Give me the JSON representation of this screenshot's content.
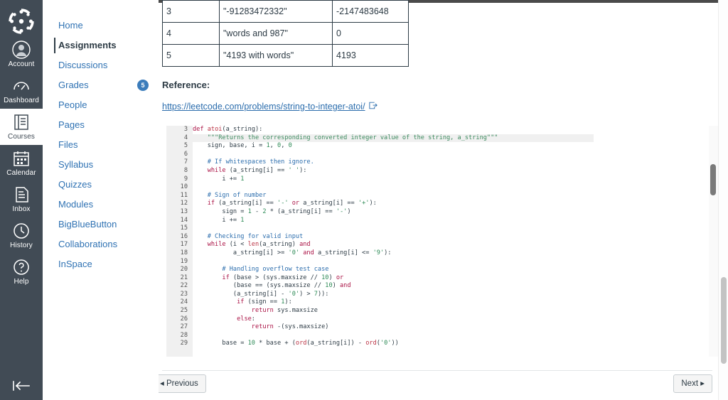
{
  "global_nav": {
    "logo": "canvas-logo",
    "items": [
      {
        "label": "Account",
        "icon": "account-avatar-icon",
        "active": false
      },
      {
        "label": "Dashboard",
        "icon": "dashboard-icon",
        "active": false
      },
      {
        "label": "Courses",
        "icon": "courses-book-icon",
        "active": true
      },
      {
        "label": "Calendar",
        "icon": "calendar-icon",
        "active": false
      },
      {
        "label": "Inbox",
        "icon": "inbox-icon",
        "active": false
      },
      {
        "label": "History",
        "icon": "history-clock-icon",
        "active": false
      },
      {
        "label": "Help",
        "icon": "help-question-icon",
        "active": false
      }
    ],
    "collapse_icon": "collapse-left-icon"
  },
  "course_nav": {
    "items": [
      {
        "label": "Home",
        "active": false,
        "badge": ""
      },
      {
        "label": "Assignments",
        "active": true,
        "badge": ""
      },
      {
        "label": "Discussions",
        "active": false,
        "badge": ""
      },
      {
        "label": "Grades",
        "active": false,
        "badge": "5"
      },
      {
        "label": "People",
        "active": false,
        "badge": ""
      },
      {
        "label": "Pages",
        "active": false,
        "badge": ""
      },
      {
        "label": "Files",
        "active": false,
        "badge": ""
      },
      {
        "label": "Syllabus",
        "active": false,
        "badge": ""
      },
      {
        "label": "Quizzes",
        "active": false,
        "badge": ""
      },
      {
        "label": "Modules",
        "active": false,
        "badge": ""
      },
      {
        "label": "BigBlueButton",
        "active": false,
        "badge": ""
      },
      {
        "label": "Collaborations",
        "active": false,
        "badge": ""
      },
      {
        "label": "InSpace",
        "active": false,
        "badge": ""
      }
    ]
  },
  "main": {
    "examples_table": {
      "rows": [
        {
          "num": "3",
          "input": "\"-91283472332\"",
          "output": "-2147483648"
        },
        {
          "num": "4",
          "input": "\"words and 987\"",
          "output": "0"
        },
        {
          "num": "5",
          "input": "\"4193 with words\"",
          "output": "4193"
        }
      ]
    },
    "reference_heading": "Reference:",
    "reference_link": "https://leetcode.com/problems/string-to-integer-atoi/",
    "external_link_icon": "external-link-icon",
    "code_block": {
      "language": "python",
      "highlighted_line": 4,
      "first_line_number": 3,
      "lines": [
        {
          "n": 3,
          "text": "def atoi(a_string):"
        },
        {
          "n": 4,
          "text": "    \"\"\"Returns the corresponding converted integer value of the string, a_string\"\"\""
        },
        {
          "n": 5,
          "text": "    sign, base, i = 1, 0, 0"
        },
        {
          "n": 6,
          "text": ""
        },
        {
          "n": 7,
          "text": "    # If whitespaces then ignore."
        },
        {
          "n": 8,
          "text": "    while (a_string[i] == ' '):"
        },
        {
          "n": 9,
          "text": "        i += 1"
        },
        {
          "n": 10,
          "text": ""
        },
        {
          "n": 11,
          "text": "    # Sign of number"
        },
        {
          "n": 12,
          "text": "    if (a_string[i] == '-' or a_string[i] == '+'):"
        },
        {
          "n": 13,
          "text": "        sign = 1 - 2 * (a_string[i] == '-')"
        },
        {
          "n": 14,
          "text": "        i += 1"
        },
        {
          "n": 15,
          "text": ""
        },
        {
          "n": 16,
          "text": "    # Checking for valid input"
        },
        {
          "n": 17,
          "text": "    while (i < len(a_string) and"
        },
        {
          "n": 18,
          "text": "           a_string[i] >= '0' and a_string[i] <= '9'):"
        },
        {
          "n": 19,
          "text": ""
        },
        {
          "n": 20,
          "text": "        # Handling overflow test case"
        },
        {
          "n": 21,
          "text": "        if (base > (sys.maxsize // 10) or"
        },
        {
          "n": 22,
          "text": "           (base == (sys.maxsize // 10) and"
        },
        {
          "n": 23,
          "text": "           (a_string[i] - '0') > 7)):"
        },
        {
          "n": 24,
          "text": "            if (sign == 1):"
        },
        {
          "n": 25,
          "text": "                return sys.maxsize"
        },
        {
          "n": 26,
          "text": "            else:"
        },
        {
          "n": 27,
          "text": "                return -(sys.maxsize)"
        },
        {
          "n": 28,
          "text": ""
        },
        {
          "n": 29,
          "text": "        base = 10 * base + (ord(a_string[i]) - ord('0'))"
        }
      ]
    }
  },
  "footer": {
    "previous_label": "◂ Previous",
    "next_label": "Next ▸"
  },
  "colors": {
    "nav_dark": "#414b55",
    "link_blue": "#2f72b3",
    "badge_blue": "#3b7cbb",
    "text_dark": "#2d3b45",
    "code_gutter": "#f0f0f0"
  }
}
